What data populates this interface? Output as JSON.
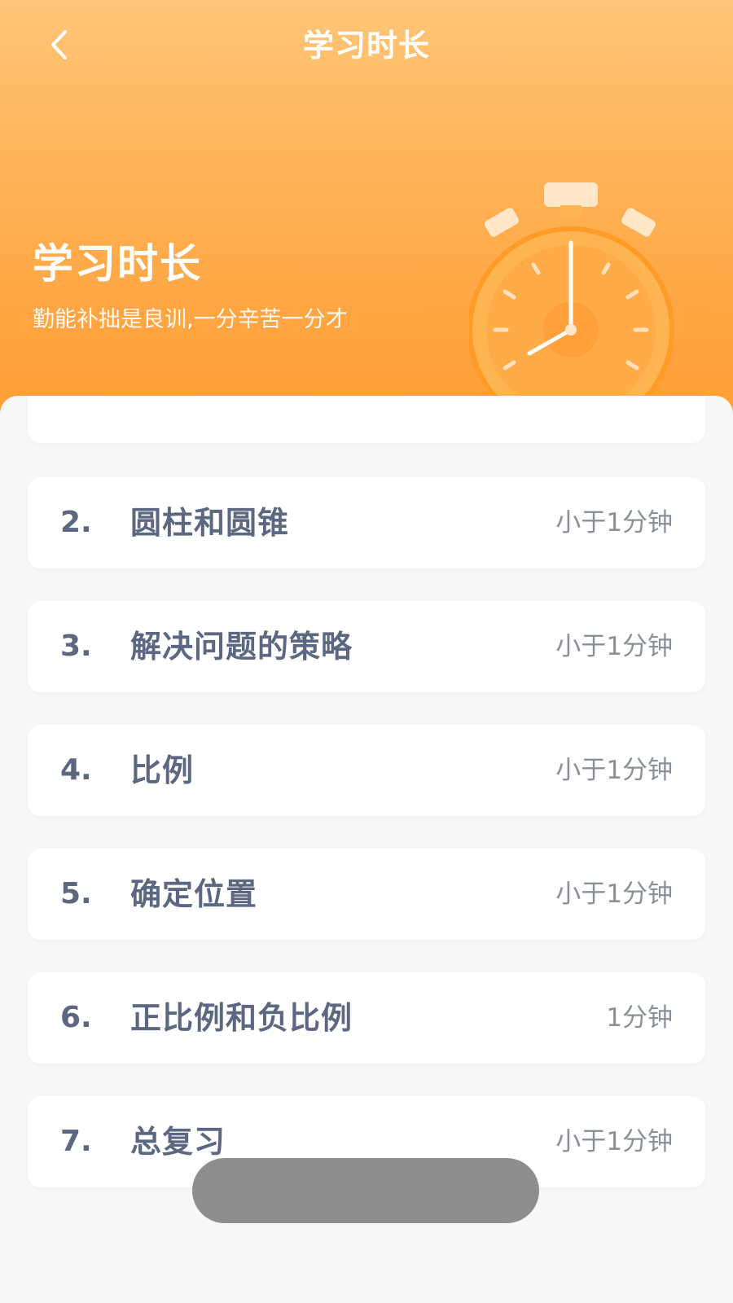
{
  "nav": {
    "back_icon": "chevron-left-icon",
    "title": "学习时长"
  },
  "hero": {
    "title": "学习时长",
    "subtitle": "勤能补拙是良训,一分辛苦一分才",
    "illustration": "stopwatch-icon"
  },
  "lessons": [
    {
      "number": "2.",
      "name": "圆柱和圆锥",
      "duration": "小于1分钟"
    },
    {
      "number": "3.",
      "name": "解决问题的策略",
      "duration": "小于1分钟"
    },
    {
      "number": "4.",
      "name": "比例",
      "duration": "小于1分钟"
    },
    {
      "number": "5.",
      "name": "确定位置",
      "duration": "小于1分钟"
    },
    {
      "number": "6.",
      "name": "正比例和负比例",
      "duration": "1分钟"
    },
    {
      "number": "7.",
      "name": "总复习",
      "duration": "小于1分钟"
    }
  ],
  "colors": {
    "accent": "#ffa33e",
    "accent_light": "#ffc679",
    "text_primary": "#5c6781",
    "text_secondary": "#8a8f9a",
    "background": "#f7f7f8"
  }
}
